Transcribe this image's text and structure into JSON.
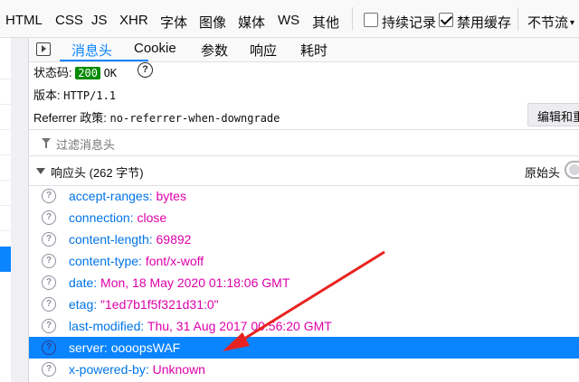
{
  "filter_bar": {
    "types": [
      "HTML",
      "CSS",
      "JS",
      "XHR",
      "字体",
      "图像",
      "媒体",
      "WS",
      "其他"
    ],
    "persist_logs": {
      "label": "持续记录",
      "checked": false
    },
    "disable_cache": {
      "label": "禁用缓存",
      "checked": true
    },
    "throttling": "不节流"
  },
  "tabs": {
    "items": [
      "消息头",
      "Cookie",
      "参数",
      "响应",
      "耗时"
    ],
    "active": "消息头"
  },
  "summary": {
    "status_label": "状态码:",
    "status_code": "200",
    "status_text": "OK",
    "version_label": "版本:",
    "version_value": "HTTP/1.1",
    "referrer_label": "Referrer 政策:",
    "referrer_value": "no-referrer-when-downgrade",
    "edit_button": "编辑和重发"
  },
  "filter": {
    "placeholder": "过滤消息头"
  },
  "response_headers": {
    "title": "响应头 (262 字节)",
    "raw_label": "原始头",
    "raw_enabled": false,
    "rows": [
      {
        "name": "accept-ranges:",
        "value": "bytes",
        "selected": false
      },
      {
        "name": "connection:",
        "value": "close",
        "selected": false
      },
      {
        "name": "content-length:",
        "value": "69892",
        "selected": false
      },
      {
        "name": "content-type:",
        "value": "font/x-woff",
        "selected": false
      },
      {
        "name": "date:",
        "value": "Mon, 18 May 2020 01:18:06 GMT",
        "selected": false
      },
      {
        "name": "etag:",
        "value": "\"1ed7b1f5f321d31:0\"",
        "selected": false
      },
      {
        "name": "last-modified:",
        "value": "Thu, 31 Aug 2017 00:56:20 GMT",
        "selected": false
      },
      {
        "name": "server:",
        "value": "oooopsWAF",
        "selected": true
      },
      {
        "name": "x-powered-by:",
        "value": "Unknown",
        "selected": false
      }
    ]
  },
  "colors": {
    "accent": "#0a84ff",
    "header_name": "#0074e8",
    "header_value": "#dd00a9",
    "status_badge": "#058b00",
    "annotation_arrow": "#e8231f"
  }
}
